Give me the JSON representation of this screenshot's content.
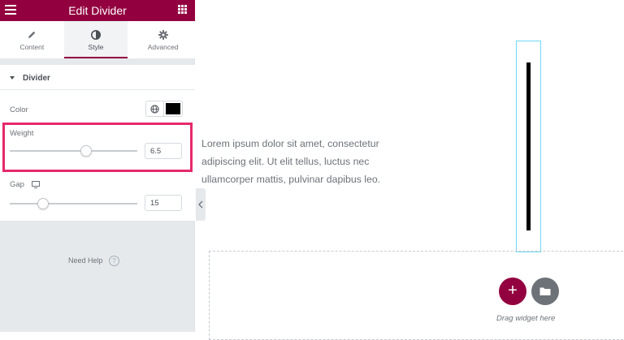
{
  "panel": {
    "title": "Edit Divider",
    "tabs": [
      {
        "label": "Content",
        "icon": "pencil-icon"
      },
      {
        "label": "Style",
        "icon": "half-circle-icon"
      },
      {
        "label": "Advanced",
        "icon": "gear-icon"
      }
    ],
    "active_tab": "Style",
    "section_title": "Divider",
    "color": {
      "label": "Color",
      "value": "#000000"
    },
    "weight": {
      "label": "Weight",
      "value": "6.5",
      "fraction": 0.6
    },
    "gap": {
      "label": "Gap",
      "value": "15",
      "fraction": 0.26
    },
    "help": "Need Help",
    "help_icon": "?"
  },
  "canvas": {
    "text": "Lorem ipsum dolor sit amet, consectetur adipiscing elit. Ut elit tellus, luctus nec ullamcorper mattis, pulvinar dapibus leo.",
    "add_label": "+",
    "drag_text": "Drag widget here"
  },
  "colors": {
    "brand": "#93003f",
    "highlight": "#e6296b",
    "selection": "#71d7f7"
  }
}
